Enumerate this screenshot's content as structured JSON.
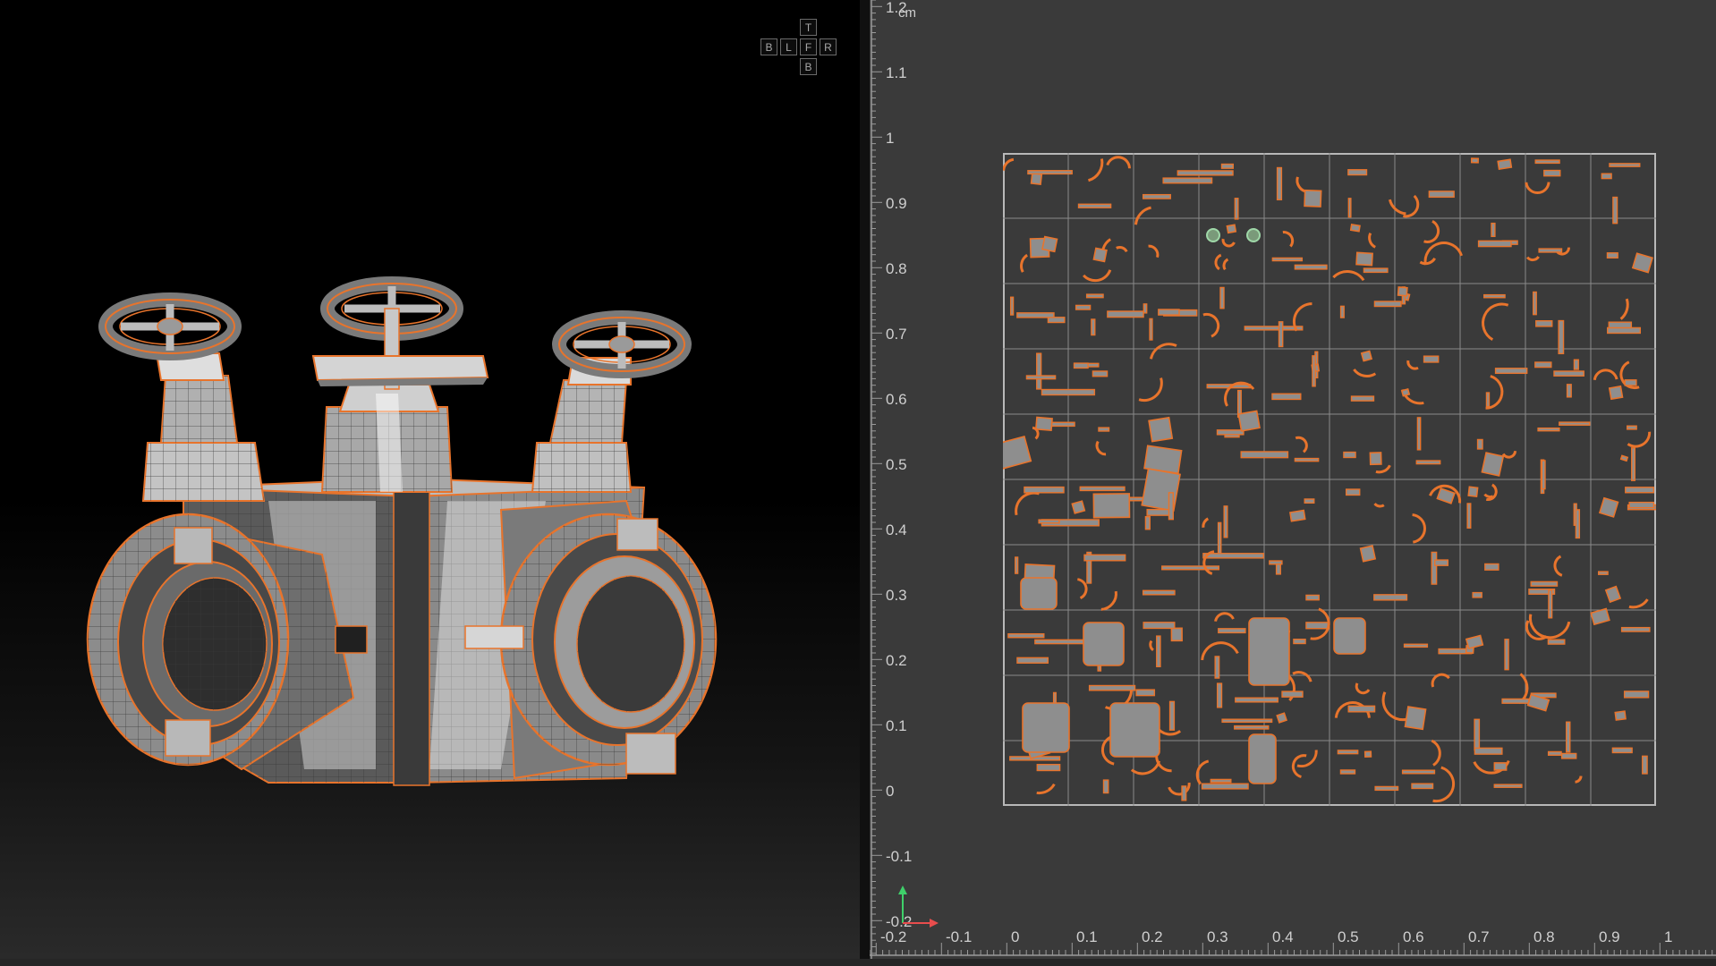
{
  "view_cube": {
    "top": "T",
    "back": "B",
    "left": "L",
    "front": "F",
    "right": "R",
    "bottom": "B"
  },
  "uv_editor": {
    "unit_label": "cm",
    "v_axis_labels": [
      "1.2",
      "1.1",
      "1",
      "0.9",
      "0.8",
      "0.7",
      "0.6",
      "0.5",
      "0.4",
      "0.3",
      "0.2",
      "0.1",
      "0",
      "-0.1",
      "-0.2"
    ],
    "u_axis_labels": [
      "-0.2",
      "-0.1",
      "0",
      "0.1",
      "0.2",
      "0.3",
      "0.4",
      "0.5",
      "0.6",
      "0.7",
      "0.8",
      "0.9",
      "1"
    ],
    "uv_tile_grid": "10x10",
    "island_fill_color": "#8e8e8e",
    "seam_color": "#e8742c",
    "axis_colors": {
      "u": "#e84d4d",
      "v": "#3fd06a"
    }
  },
  "viewport": {
    "wire_color": "#e8742c",
    "model": "valve manifold with three handwheels"
  }
}
